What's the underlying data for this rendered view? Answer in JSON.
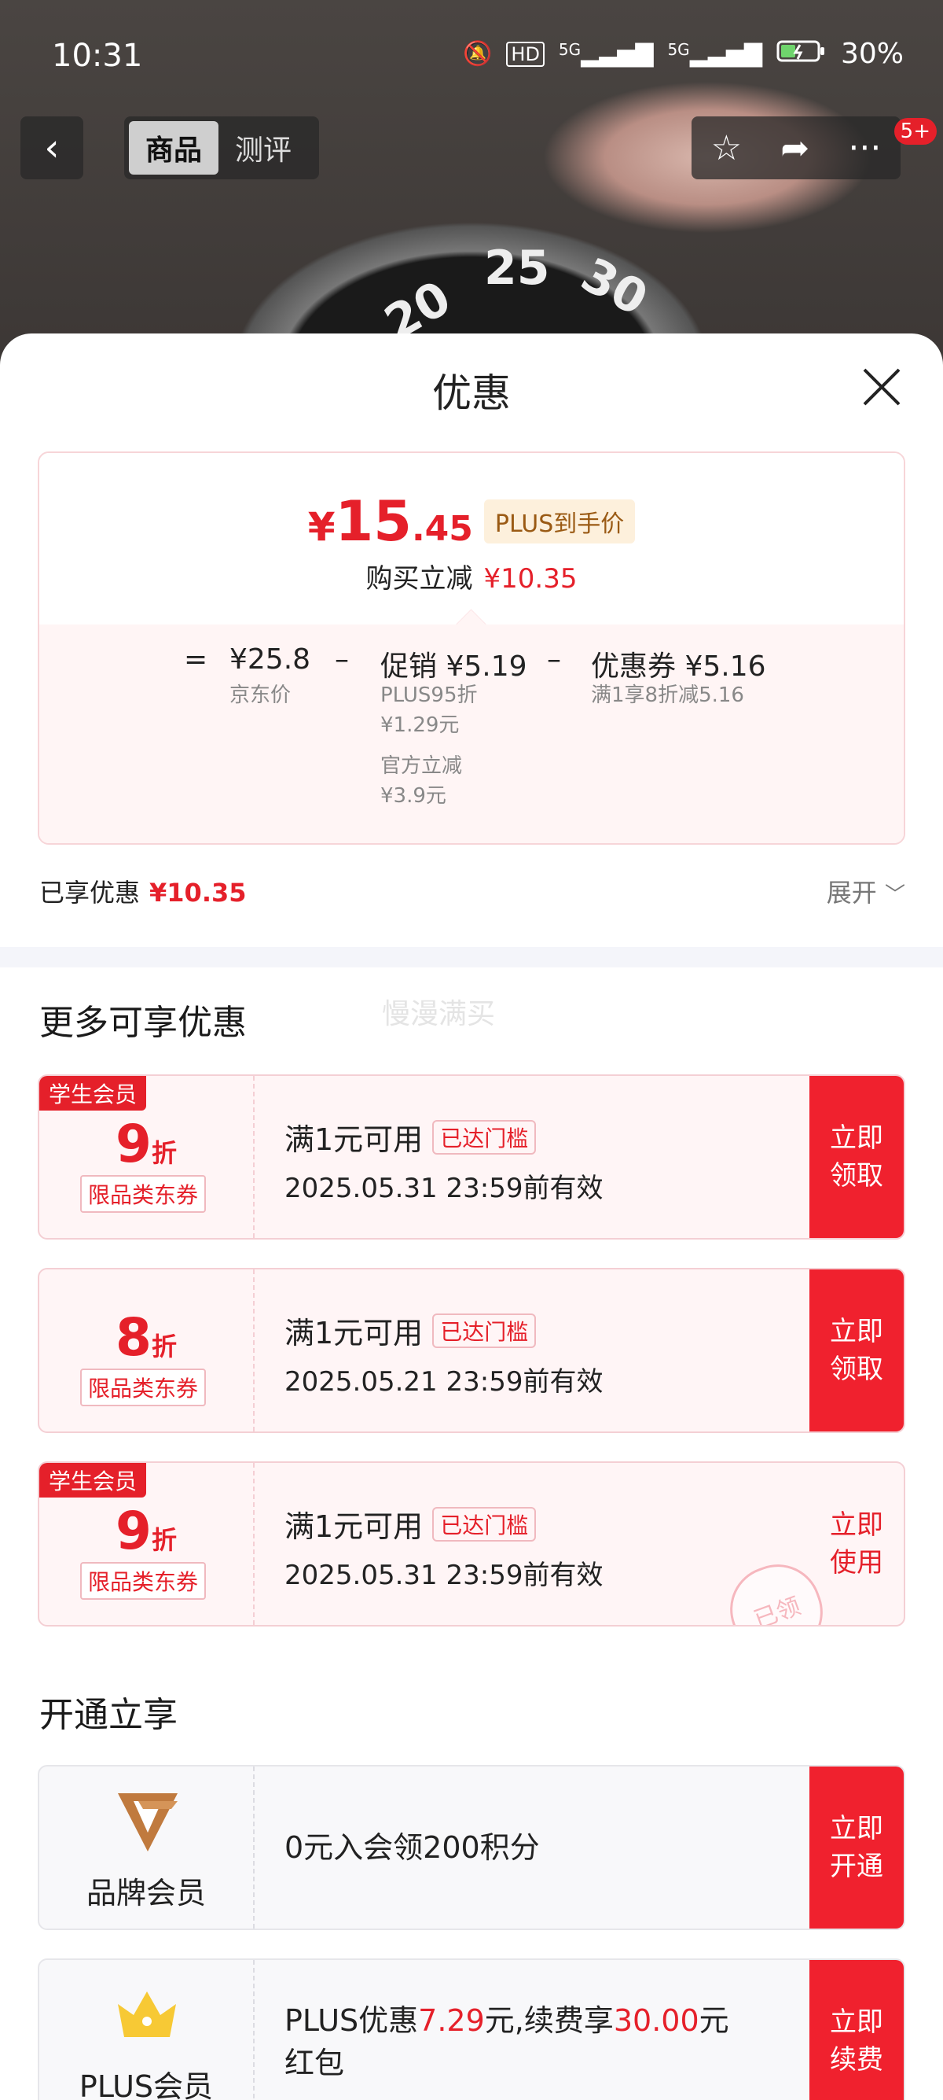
{
  "status_bar": {
    "time": "10:31",
    "battery": "30%",
    "net1": "5G",
    "net2": "5G",
    "hd": "HD"
  },
  "top_nav": {
    "tabs": [
      "商品",
      "测评"
    ],
    "badge": "5+"
  },
  "background": {
    "dial_numbers": [
      "20",
      "25",
      "30"
    ]
  },
  "sheet": {
    "title": "优惠"
  },
  "price_card": {
    "price_symbol": "¥",
    "price_int": "15",
    "price_dec": ".45",
    "tag": "PLUS到手价",
    "reduce_label": "购买立减",
    "reduce_amount": "¥10.35",
    "eq": "=",
    "jd_price": "¥25.8",
    "jd_label": "京东价",
    "minus1": "–",
    "promo_label": "促销 ¥5.19",
    "promo_sub1": "PLUS95折",
    "promo_sub1_val": "¥1.29元",
    "promo_sub2": "官方立减",
    "promo_sub2_val": "¥3.9元",
    "minus2": "–",
    "coupon_label": "优惠券 ¥5.16",
    "coupon_sub": "满1享8折减5.16"
  },
  "enjoyed": {
    "label": "已享优惠",
    "amount": "¥10.35",
    "expand": "展开"
  },
  "more": {
    "title": "更多可享优惠",
    "ghost": "慢漫满买"
  },
  "coupons": [
    {
      "student": "学生会员",
      "num": "9",
      "zhe": "折",
      "cat": "限品类东券",
      "cond": "满1元可用",
      "reached": "已达门槛",
      "valid": "2025.05.31 23:59前有效",
      "btn1": "立即",
      "btn2": "领取"
    },
    {
      "student": "",
      "num": "8",
      "zhe": "折",
      "cat": "限品类东券",
      "cond": "满1元可用",
      "reached": "已达门槛",
      "valid": "2025.05.21 23:59前有效",
      "btn1": "立即",
      "btn2": "领取"
    },
    {
      "student": "学生会员",
      "num": "9",
      "zhe": "折",
      "cat": "限品类东券",
      "cond": "满1元可用",
      "reached": "已达门槛",
      "valid": "2025.05.31 23:59前有效",
      "btn1": "立即",
      "btn2": "使用",
      "stamp": "已领"
    }
  ],
  "open": {
    "title": "开通立享"
  },
  "members": [
    {
      "name": "品牌会员",
      "text": "0元入会领200积分",
      "btn1": "立即",
      "btn2": "开通"
    },
    {
      "name": "PLUS会员",
      "text_a": "PLUS优惠",
      "text_b": "7.29",
      "text_c": "元,续费享",
      "text_d": "30.00",
      "text_e": "元",
      "text_f": "红包",
      "btn1": "立即",
      "btn2": "续费"
    }
  ]
}
